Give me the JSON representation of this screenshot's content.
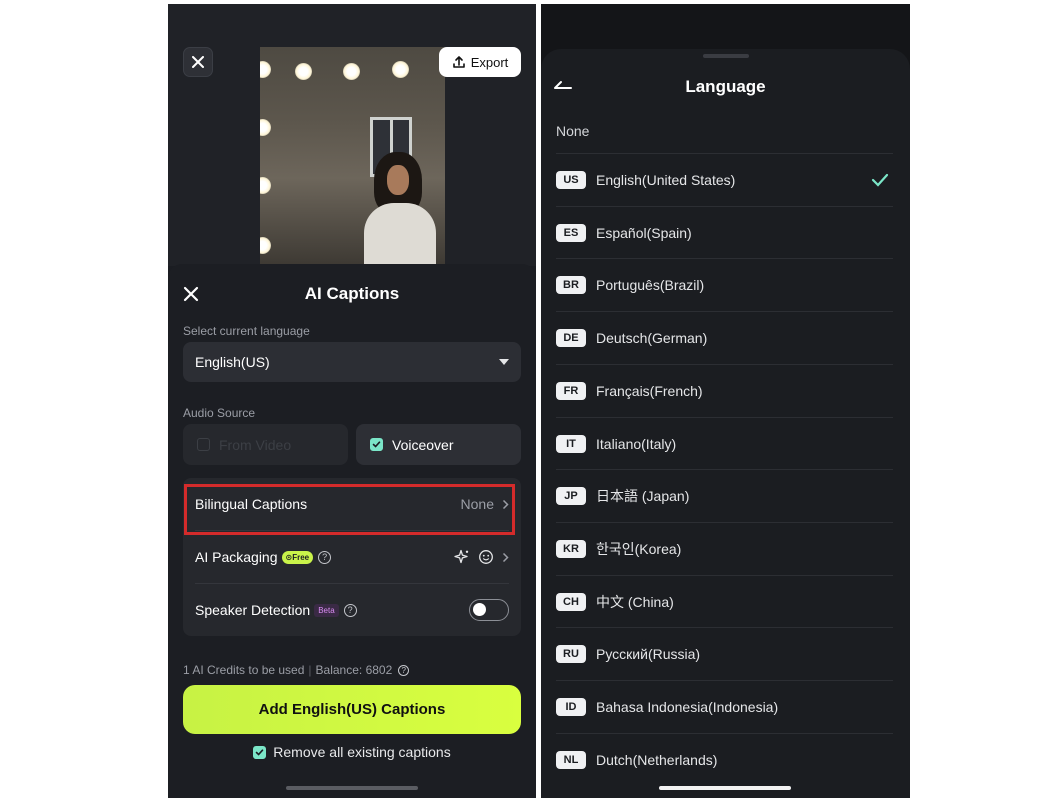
{
  "left": {
    "export_label": "Export",
    "sheet_title": "AI Captions",
    "select_language_label": "Select current language",
    "selected_language": "English(US)",
    "audio_source_label": "Audio Source",
    "audio_sources": [
      {
        "label": "From Video",
        "checked": false,
        "disabled": true
      },
      {
        "label": "Voiceover",
        "checked": true,
        "disabled": false
      }
    ],
    "bilingual": {
      "label": "Bilingual Captions",
      "value": "None"
    },
    "ai_packaging": {
      "label": "AI Packaging",
      "badge": "Free"
    },
    "speaker_detection": {
      "label": "Speaker Detection",
      "badge": "Beta",
      "enabled": false
    },
    "credits_text": "1 AI Credits to be used",
    "balance_text": "Balance: 6802",
    "add_button_label": "Add English(US) Captions",
    "remove_label": "Remove all existing captions",
    "remove_checked": true,
    "accent_color": "#c9f34a",
    "highlight_color": "#d42b2b"
  },
  "right": {
    "title": "Language",
    "none_label": "None",
    "languages": [
      {
        "code": "US",
        "name": "English(United States)",
        "selected": true
      },
      {
        "code": "ES",
        "name": "Español(Spain)",
        "selected": false
      },
      {
        "code": "BR",
        "name": "Português(Brazil)",
        "selected": false
      },
      {
        "code": "DE",
        "name": "Deutsch(German)",
        "selected": false
      },
      {
        "code": "FR",
        "name": "Français(French)",
        "selected": false
      },
      {
        "code": "IT",
        "name": "Italiano(Italy)",
        "selected": false
      },
      {
        "code": "JP",
        "name": "日本語 (Japan)",
        "selected": false
      },
      {
        "code": "KR",
        "name": "한국인(Korea)",
        "selected": false
      },
      {
        "code": "CH",
        "name": "中文 (China)",
        "selected": false
      },
      {
        "code": "RU",
        "name": "Русский(Russia)",
        "selected": false
      },
      {
        "code": "ID",
        "name": "Bahasa Indonesia(Indonesia)",
        "selected": false
      },
      {
        "code": "NL",
        "name": "Dutch(Netherlands)",
        "selected": false
      }
    ],
    "check_color": "#7be6c8"
  }
}
